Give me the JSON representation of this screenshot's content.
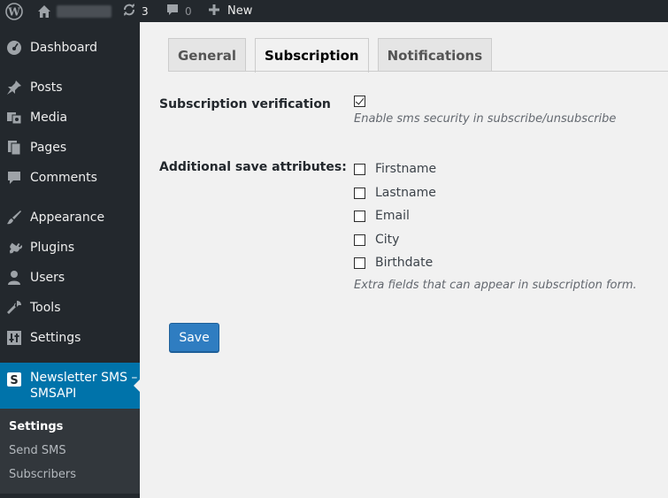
{
  "adminbar": {
    "updates_count": "3",
    "comments_count": "0",
    "new_label": "New"
  },
  "sidebar": {
    "items": [
      {
        "label": "Dashboard",
        "icon": "dashboard-icon"
      },
      {
        "label": "Posts",
        "icon": "pin-icon"
      },
      {
        "label": "Media",
        "icon": "media-icon"
      },
      {
        "label": "Pages",
        "icon": "pages-icon"
      },
      {
        "label": "Comments",
        "icon": "comment-icon"
      },
      {
        "label": "Appearance",
        "icon": "brush-icon"
      },
      {
        "label": "Plugins",
        "icon": "plugin-icon"
      },
      {
        "label": "Users",
        "icon": "user-icon"
      },
      {
        "label": "Tools",
        "icon": "wrench-icon"
      },
      {
        "label": "Settings",
        "icon": "settings-icon"
      }
    ],
    "active_item": {
      "label": "Newsletter SMS – SMSAPI",
      "icon": "smsapi-icon"
    },
    "submenu": [
      "Settings",
      "Send SMS",
      "Subscribers"
    ]
  },
  "tabs": [
    "General",
    "Subscription",
    "Notifications"
  ],
  "active_tab": "Subscription",
  "form": {
    "verification": {
      "label": "Subscription verification",
      "checked": true,
      "description": "Enable sms security in subscribe/unsubscribe"
    },
    "attributes": {
      "label": "Additional save attributes:",
      "options": [
        {
          "label": "Firstname",
          "checked": false
        },
        {
          "label": "Lastname",
          "checked": false
        },
        {
          "label": "Email",
          "checked": false
        },
        {
          "label": "City",
          "checked": false
        },
        {
          "label": "Birthdate",
          "checked": false
        }
      ],
      "description": "Extra fields that can appear in subscription form."
    },
    "save_label": "Save"
  },
  "colors": {
    "admin_dark": "#23282d",
    "submenu_bg": "#32373c",
    "accent_blue": "#0073aa",
    "button_blue": "#2f7dc1",
    "content_bg": "#f1f1f1"
  }
}
